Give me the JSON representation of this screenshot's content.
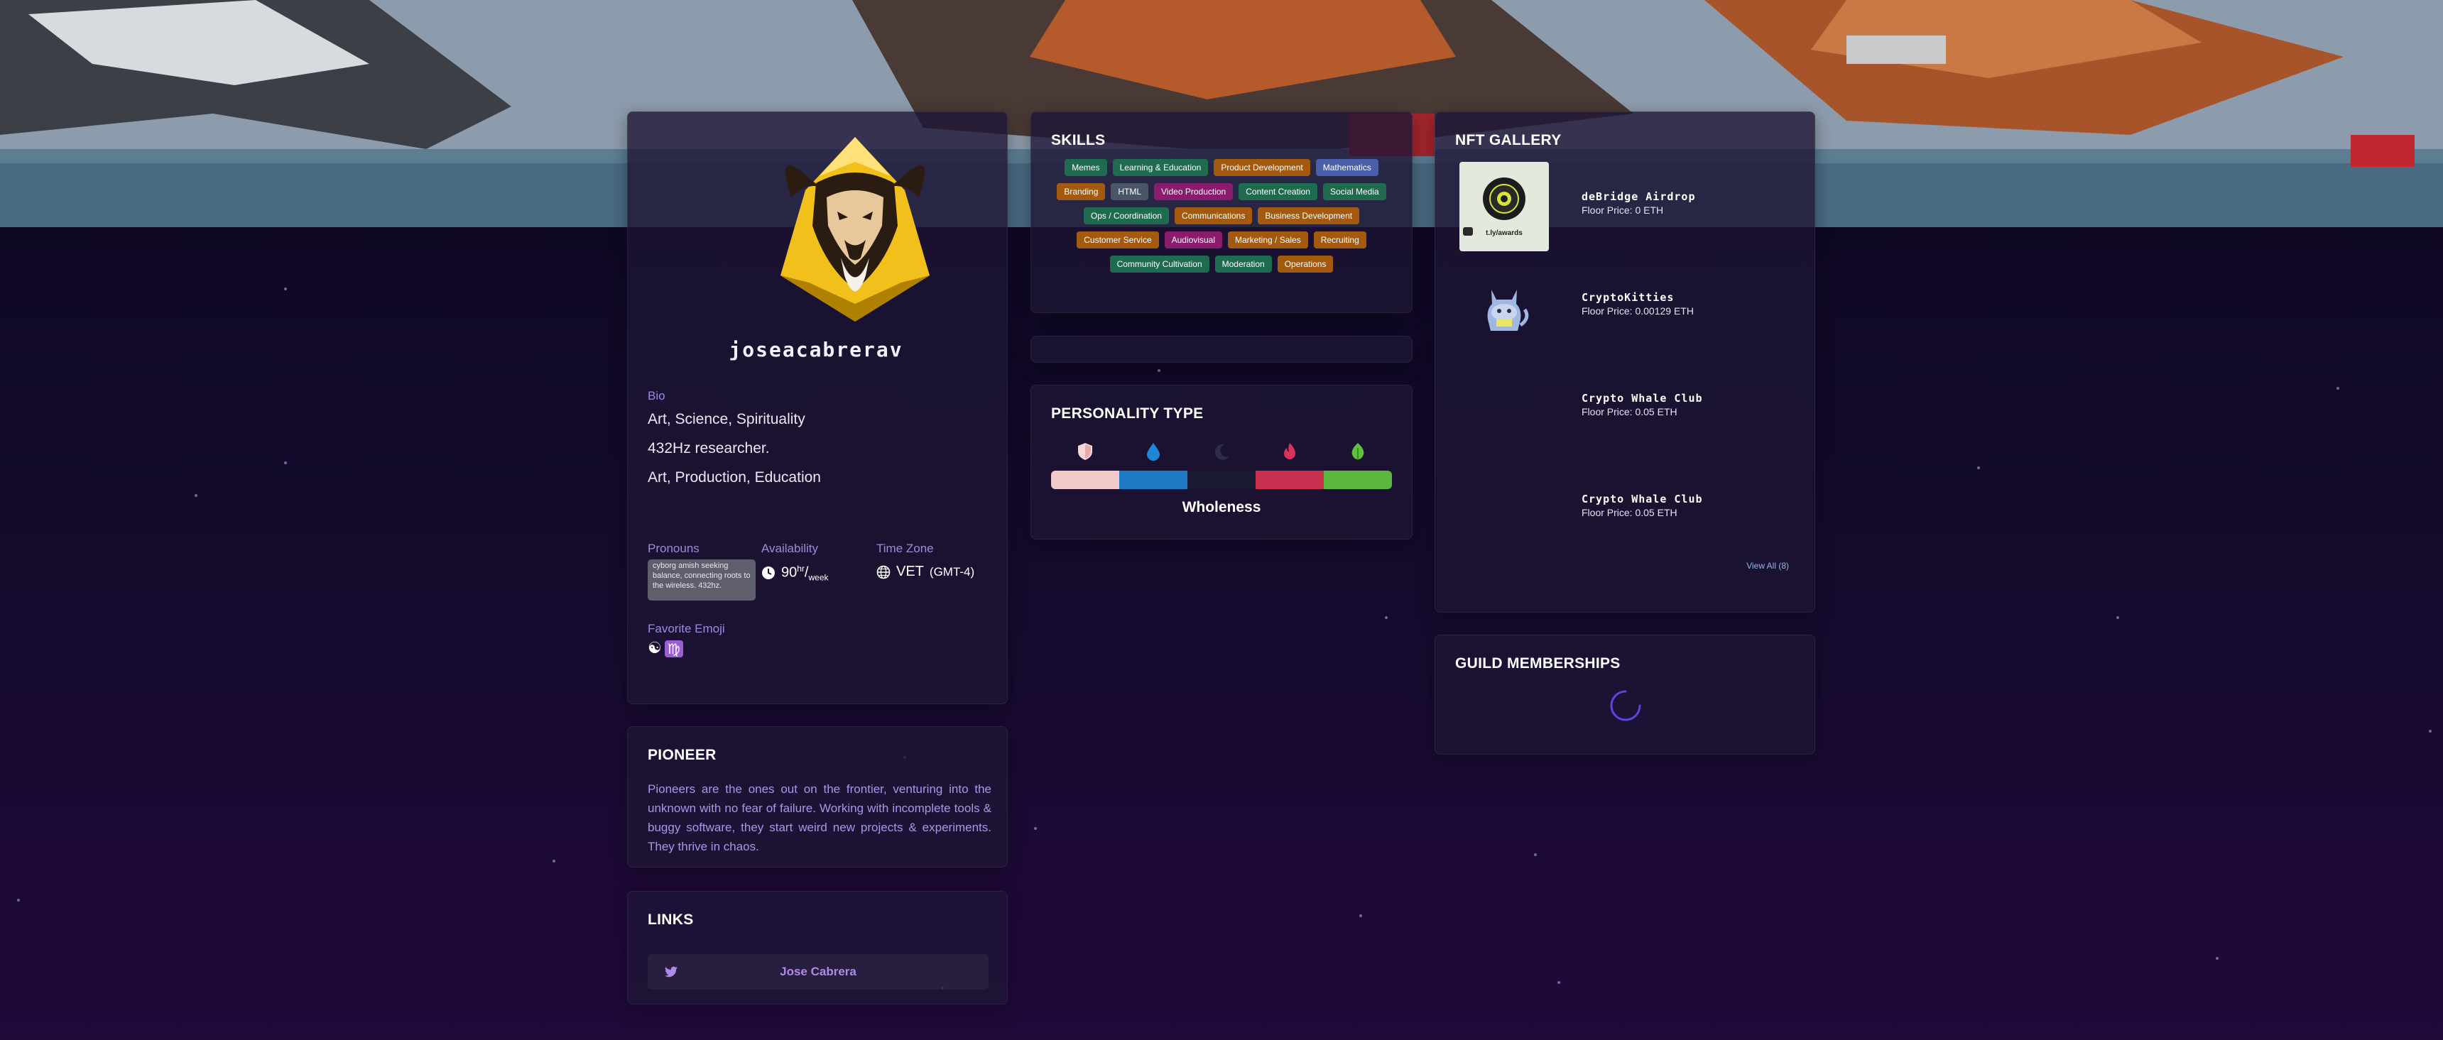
{
  "profile": {
    "username": "joseacabrerav",
    "bio_label": "Bio",
    "bio_lines": [
      "Art, Science, Spirituality",
      "432Hz researcher.",
      "Art, Production, Education"
    ],
    "pronouns_label": "Pronouns",
    "pronouns_value": "cyborg amish seeking balance, connecting roots to the wireless. 432hz.",
    "availability_label": "Availability",
    "availability_value": "90",
    "availability_unit_top": "hr",
    "availability_unit_bottom": "week",
    "timezone_label": "Time Zone",
    "timezone_value": "VET",
    "timezone_offset": "(GMT-4)",
    "favorite_emoji_label": "Favorite Emoji",
    "favorite_emoji": [
      "☯",
      "♍"
    ]
  },
  "pioneer": {
    "title": "PIONEER",
    "text": "Pioneers are the ones out on the frontier, venturing into the unknown with no fear of failure. Working with incomplete tools & buggy software, they start weird new projects & experiments. They thrive in chaos."
  },
  "links": {
    "title": "LINKS",
    "items": [
      {
        "label": "Jose Cabrera",
        "icon": "twitter-icon"
      }
    ]
  },
  "skills": {
    "title": "SKILLS",
    "tags": [
      {
        "label": "Memes",
        "color": "#1f6b4f"
      },
      {
        "label": "Learning & Education",
        "color": "#1f6b4f"
      },
      {
        "label": "Product Development",
        "color": "#a35a0f"
      },
      {
        "label": "Mathematics",
        "color": "#4b5fa8"
      },
      {
        "label": "Branding",
        "color": "#a35a0f"
      },
      {
        "label": "HTML",
        "color": "#4a5568"
      },
      {
        "label": "Video Production",
        "color": "#8a1b6d"
      },
      {
        "label": "Content Creation",
        "color": "#1f6b4f"
      },
      {
        "label": "Social Media",
        "color": "#1f6b4f"
      },
      {
        "label": "Ops / Coordination",
        "color": "#1f6b4f"
      },
      {
        "label": "Communications",
        "color": "#a35a0f"
      },
      {
        "label": "Business Development",
        "color": "#a35a0f"
      },
      {
        "label": "Customer Service",
        "color": "#a35a0f"
      },
      {
        "label": "Audiovisual",
        "color": "#8a1b6d"
      },
      {
        "label": "Marketing / Sales",
        "color": "#a35a0f"
      },
      {
        "label": "Recruiting",
        "color": "#a35a0f"
      },
      {
        "label": "Community Cultivation",
        "color": "#1f6b4f"
      },
      {
        "label": "Moderation",
        "color": "#1f6b4f"
      },
      {
        "label": "Operations",
        "color": "#a35a0f"
      }
    ]
  },
  "personality": {
    "title": "PERSONALITY TYPE",
    "name": "Wholeness",
    "colors": [
      "#f2c9c9",
      "#1e7ac4",
      "#1a1a33",
      "#c7314f",
      "#5bb73d"
    ]
  },
  "nft": {
    "title": "NFT GALLERY",
    "items": [
      {
        "name": "deBridge Airdrop",
        "price": "Floor Price: 0 ETH",
        "thumb_caption": "t.ly/awards"
      },
      {
        "name": "CryptoKitties",
        "price": "Floor Price: 0.00129 ETH"
      },
      {
        "name": "Crypto Whale Club",
        "price": "Floor Price: 0.05 ETH"
      },
      {
        "name": "Crypto Whale Club",
        "price": "Floor Price: 0.05 ETH"
      }
    ],
    "view_all": "View All (8)"
  },
  "guild": {
    "title": "GUILD MEMBERSHIPS"
  }
}
